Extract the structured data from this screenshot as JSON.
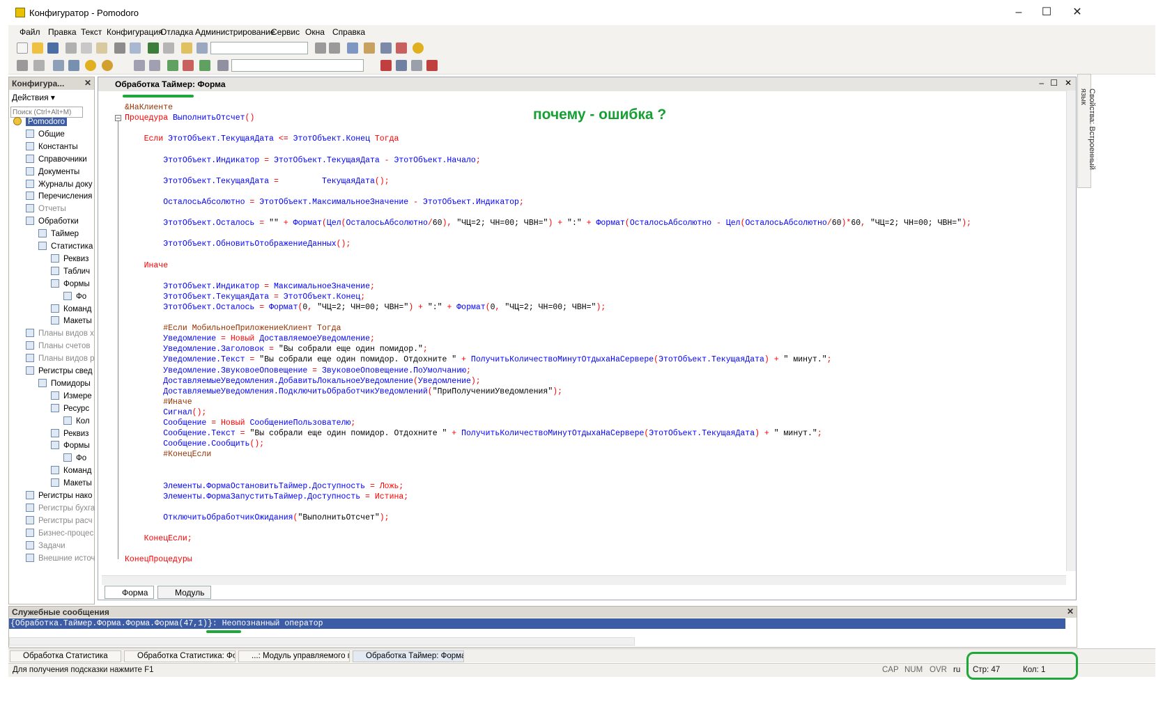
{
  "window": {
    "title": "Конфигуратор - Pomodoro"
  },
  "menu": [
    "Файл",
    "Правка",
    "Текст",
    "Конфигурация",
    "Отладка",
    "Администрирование",
    "Сервис",
    "Окна",
    "Справка"
  ],
  "left_panel": {
    "title": "Конфигура...",
    "actions_label": "Действия",
    "search_placeholder": "Поиск (Ctrl+Alt+M)",
    "tree": [
      {
        "label": "Pomodoro",
        "indent": 0,
        "selected": true
      },
      {
        "label": "Общие",
        "indent": 1
      },
      {
        "label": "Константы",
        "indent": 1
      },
      {
        "label": "Справочники",
        "indent": 1
      },
      {
        "label": "Документы",
        "indent": 1
      },
      {
        "label": "Журналы доку",
        "indent": 1
      },
      {
        "label": "Перечисления",
        "indent": 1
      },
      {
        "label": "Отчеты",
        "indent": 1,
        "muted": true
      },
      {
        "label": "Обработки",
        "indent": 1
      },
      {
        "label": "Таймер",
        "indent": 2
      },
      {
        "label": "Статистика",
        "indent": 2
      },
      {
        "label": "Реквиз",
        "indent": 3
      },
      {
        "label": "Таблич",
        "indent": 3
      },
      {
        "label": "Формы",
        "indent": 3
      },
      {
        "label": "Фо",
        "indent": 4
      },
      {
        "label": "Команд",
        "indent": 3
      },
      {
        "label": "Макеты",
        "indent": 3
      },
      {
        "label": "Планы видов х",
        "indent": 1,
        "muted": true
      },
      {
        "label": "Планы счетов",
        "indent": 1,
        "muted": true
      },
      {
        "label": "Планы видов р",
        "indent": 1,
        "muted": true
      },
      {
        "label": "Регистры свед",
        "indent": 1
      },
      {
        "label": "Помидоры",
        "indent": 2
      },
      {
        "label": "Измере",
        "indent": 3
      },
      {
        "label": "Ресурс",
        "indent": 3
      },
      {
        "label": "Кол",
        "indent": 4
      },
      {
        "label": "Реквиз",
        "indent": 3
      },
      {
        "label": "Формы",
        "indent": 3
      },
      {
        "label": "Фо",
        "indent": 4
      },
      {
        "label": "Команд",
        "indent": 3
      },
      {
        "label": "Макеты",
        "indent": 3
      },
      {
        "label": "Регистры нако",
        "indent": 1
      },
      {
        "label": "Регистры бухга",
        "indent": 1,
        "muted": true
      },
      {
        "label": "Регистры расч",
        "indent": 1,
        "muted": true
      },
      {
        "label": "Бизнес-процес",
        "indent": 1,
        "muted": true
      },
      {
        "label": "Задачи",
        "indent": 1,
        "muted": true
      },
      {
        "label": "Внешние источ",
        "indent": 1,
        "muted": true
      }
    ]
  },
  "editor": {
    "title": "Обработка Таймер: Форма",
    "annotation": "почему - ошибка ?",
    "tabs": [
      "Форма",
      "Модуль"
    ],
    "code": [
      [
        [
          "pr",
          "&НаКлиенте"
        ]
      ],
      [
        [
          "kw",
          "Процедура "
        ],
        [
          "id",
          "ВыполнитьОтсчет"
        ],
        [
          "kw",
          "()"
        ]
      ],
      [],
      [
        [
          "kw",
          "    Если "
        ],
        [
          "id",
          "ЭтотОбъект.ТекущаяДата"
        ],
        [
          "kw",
          " <= "
        ],
        [
          "id",
          "ЭтотОбъект.Конец"
        ],
        [
          "kw",
          " Тогда"
        ]
      ],
      [],
      [
        [
          "id",
          "        ЭтотОбъект.Индикатор"
        ],
        [
          "kw",
          " = "
        ],
        [
          "id",
          "ЭтотОбъект.ТекущаяДата"
        ],
        [
          "kw",
          " - "
        ],
        [
          "id",
          "ЭтотОбъект.Начало"
        ],
        [
          "kw",
          ";"
        ]
      ],
      [],
      [
        [
          "id",
          "        ЭтотОбъект.ТекущаяДата"
        ],
        [
          "kw",
          " =         "
        ],
        [
          "id",
          "ТекущаяДата"
        ],
        [
          "kw",
          "();"
        ]
      ],
      [],
      [
        [
          "id",
          "        ОсталосьАбсолютно"
        ],
        [
          "kw",
          " = "
        ],
        [
          "id",
          "ЭтотОбъект.МаксимальноеЗначение"
        ],
        [
          "kw",
          " - "
        ],
        [
          "id",
          "ЭтотОбъект.Индикатор"
        ],
        [
          "kw",
          ";"
        ]
      ],
      [],
      [
        [
          "id",
          "        ЭтотОбъект.Осталось"
        ],
        [
          "kw",
          " = "
        ],
        [
          "st",
          "\"\""
        ],
        [
          "kw",
          " + "
        ],
        [
          "id",
          "Формат"
        ],
        [
          "kw",
          "("
        ],
        [
          "id",
          "Цел"
        ],
        [
          "kw",
          "("
        ],
        [
          "id",
          "ОсталосьАбсолютно"
        ],
        [
          "kw",
          "/"
        ],
        [
          "st",
          "60"
        ],
        [
          "kw",
          "), "
        ],
        [
          "st",
          "\"ЧЦ=2; ЧН=00; ЧВН=\""
        ],
        [
          "kw",
          ") + "
        ],
        [
          "st",
          "\":\""
        ],
        [
          "kw",
          " + "
        ],
        [
          "id",
          "Формат"
        ],
        [
          "kw",
          "("
        ],
        [
          "id",
          "ОсталосьАбсолютно"
        ],
        [
          "kw",
          " - "
        ],
        [
          "id",
          "Цел"
        ],
        [
          "kw",
          "("
        ],
        [
          "id",
          "ОсталосьАбсолютно"
        ],
        [
          "kw",
          "/"
        ],
        [
          "st",
          "60"
        ],
        [
          "kw",
          ")*"
        ],
        [
          "st",
          "60"
        ],
        [
          "kw",
          ", "
        ],
        [
          "st",
          "\"ЧЦ=2; ЧН=00; ЧВН=\""
        ],
        [
          "kw",
          ");"
        ]
      ],
      [],
      [
        [
          "id",
          "        ЭтотОбъект.ОбновитьОтображениеДанных"
        ],
        [
          "kw",
          "();"
        ]
      ],
      [],
      [
        [
          "kw",
          "    Иначе"
        ]
      ],
      [],
      [
        [
          "id",
          "        ЭтотОбъект.Индикатор"
        ],
        [
          "kw",
          " = "
        ],
        [
          "id",
          "МаксимальноеЗначение"
        ],
        [
          "kw",
          ";"
        ]
      ],
      [
        [
          "id",
          "        ЭтотОбъект.ТекущаяДата"
        ],
        [
          "kw",
          " = "
        ],
        [
          "id",
          "ЭтотОбъект.Конец"
        ],
        [
          "kw",
          ";"
        ]
      ],
      [
        [
          "id",
          "        ЭтотОбъект.Осталось"
        ],
        [
          "kw",
          " = "
        ],
        [
          "id",
          "Формат"
        ],
        [
          "kw",
          "("
        ],
        [
          "st",
          "0"
        ],
        [
          "kw",
          ", "
        ],
        [
          "st",
          "\"ЧЦ=2; ЧН=00; ЧВН=\""
        ],
        [
          "kw",
          ") + "
        ],
        [
          "st",
          "\":\""
        ],
        [
          "kw",
          " + "
        ],
        [
          "id",
          "Формат"
        ],
        [
          "kw",
          "("
        ],
        [
          "st",
          "0"
        ],
        [
          "kw",
          ", "
        ],
        [
          "st",
          "\"ЧЦ=2; ЧН=00; ЧВН=\""
        ],
        [
          "kw",
          ");"
        ]
      ],
      [],
      [
        [
          "pr",
          "        #Если МобильноеПриложениеКлиент Тогда"
        ]
      ],
      [
        [
          "id",
          "        Уведомление"
        ],
        [
          "kw",
          " = Новый "
        ],
        [
          "id",
          "ДоставляемоеУведомление"
        ],
        [
          "kw",
          ";"
        ]
      ],
      [
        [
          "id",
          "        Уведомление.Заголовок"
        ],
        [
          "kw",
          " = "
        ],
        [
          "st",
          "\"Вы собрали еще один помидор.\""
        ],
        [
          "kw",
          ";"
        ]
      ],
      [
        [
          "id",
          "        Уведомление.Текст"
        ],
        [
          "kw",
          " = "
        ],
        [
          "st",
          "\"Вы собрали еще один помидор. Отдохните \""
        ],
        [
          "kw",
          " + "
        ],
        [
          "id",
          "ПолучитьКоличествоМинутОтдыхаНаСервере"
        ],
        [
          "kw",
          "("
        ],
        [
          "id",
          "ЭтотОбъект.ТекущаяДата"
        ],
        [
          "kw",
          ") + "
        ],
        [
          "st",
          "\" минут.\""
        ],
        [
          "kw",
          ";"
        ]
      ],
      [
        [
          "id",
          "        Уведомление.ЗвуковоеОповещение"
        ],
        [
          "kw",
          " = "
        ],
        [
          "id",
          "ЗвуковоеОповещение.ПоУмолчанию"
        ],
        [
          "kw",
          ";"
        ]
      ],
      [
        [
          "id",
          "        ДоставляемыеУведомления.ДобавитьЛокальноеУведомление"
        ],
        [
          "kw",
          "("
        ],
        [
          "id",
          "Уведомление"
        ],
        [
          "kw",
          ");"
        ]
      ],
      [
        [
          "id",
          "        ДоставляемыеУведомления.ПодключитьОбработчикУведомлений"
        ],
        [
          "kw",
          "("
        ],
        [
          "st",
          "\"ПриПолученииУведомления\""
        ],
        [
          "kw",
          ");"
        ]
      ],
      [
        [
          "pr",
          "        #Иначе"
        ]
      ],
      [
        [
          "id",
          "        Сигнал"
        ],
        [
          "kw",
          "();"
        ]
      ],
      [
        [
          "id",
          "        Сообщение"
        ],
        [
          "kw",
          " = Новый "
        ],
        [
          "id",
          "СообщениеПользователю"
        ],
        [
          "kw",
          ";"
        ]
      ],
      [
        [
          "id",
          "        Сообщение.Текст"
        ],
        [
          "kw",
          " = "
        ],
        [
          "st",
          "\"Вы собрали еще один помидор. Отдохните \""
        ],
        [
          "kw",
          " + "
        ],
        [
          "id",
          "ПолучитьКоличествоМинутОтдыхаНаСервере"
        ],
        [
          "kw",
          "("
        ],
        [
          "id",
          "ЭтотОбъект.ТекущаяДата"
        ],
        [
          "kw",
          ") + "
        ],
        [
          "st",
          "\" минут.\""
        ],
        [
          "kw",
          ";"
        ]
      ],
      [
        [
          "id",
          "        Сообщение.Сообщить"
        ],
        [
          "kw",
          "();"
        ]
      ],
      [
        [
          "pr",
          "        #КонецЕсли"
        ]
      ],
      [],
      [],
      [
        [
          "id",
          "        Элементы.ФормаОстановитьТаймер.Доступность"
        ],
        [
          "kw",
          " = Ложь;"
        ]
      ],
      [
        [
          "id",
          "        Элементы.ФормаЗапуститьТаймер.Доступность"
        ],
        [
          "kw",
          " = Истина;"
        ]
      ],
      [],
      [
        [
          "id",
          "        ОтключитьОбработчикОжидания"
        ],
        [
          "kw",
          "("
        ],
        [
          "st",
          "\"ВыполнитьОтсчет\""
        ],
        [
          "kw",
          ");"
        ]
      ],
      [],
      [
        [
          "kw",
          "    КонецЕсли;"
        ]
      ],
      [],
      [
        [
          "kw",
          "КонецПроцедуры"
        ]
      ]
    ]
  },
  "right_strip": "Свойства: Встроенный язык",
  "messages": {
    "title": "Служебные сообщения",
    "error": "{Обработка.Таймер.Форма.Форма.Форма(47,1)}: Неопознанный оператор"
  },
  "tasks": [
    "Обработка Статистика",
    "Обработка Статистика: Фо...",
    "...: Модуль управляемого п...",
    "Обработка Таймер: Форма"
  ],
  "status": {
    "hint": "Для получения подсказки нажмите F1",
    "cap": "CAP",
    "num": "NUM",
    "ovr": "OVR",
    "lang": "ru",
    "line": "Стр: 47",
    "col": "Кол: 1"
  }
}
